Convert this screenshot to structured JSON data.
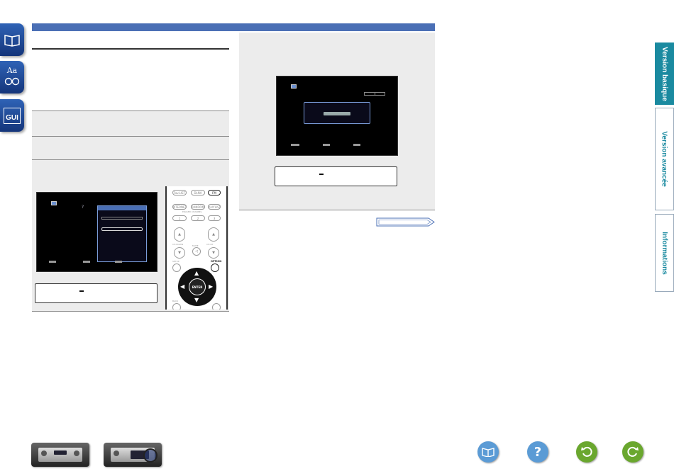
{
  "side_tabs": [
    {
      "icon": "book-icon"
    },
    {
      "icon": "glossary-icon",
      "label": "Aa"
    },
    {
      "icon": "gui-icon",
      "label": "GUI"
    }
  ],
  "right_tabs": [
    {
      "label": "Version basique",
      "active": true
    },
    {
      "label": "Version avancée",
      "active": false
    },
    {
      "label": "Informations",
      "active": false
    }
  ],
  "remote": {
    "top_keys": [
      "Fav.LIST",
      "DLNA",
      "FM"
    ],
    "second_keys": [
      "INTERNET",
      "RANDOM",
      "PLAYLIST"
    ],
    "section_label": "ERASED CHANNEL",
    "number_keys": [
      "1",
      "2",
      "3"
    ],
    "ch_down": "CH.DOWN",
    "mute": "MUTE",
    "ch_up": "CH.UP",
    "option_label": "OPTION",
    "enter_label": "ENTER",
    "setup_label": "SETUP",
    "back_label": "BACK"
  },
  "colors": {
    "accent_blue": "#4a6fb5",
    "tab_teal": "#1a8aa0",
    "icon_blue": "#5b9bd5",
    "icon_green": "#6aa72e"
  },
  "bottom_icons": [
    "book-icon",
    "help-icon",
    "back-icon",
    "forward-icon"
  ],
  "help_glyph": "?",
  "tv_glyph": "?"
}
